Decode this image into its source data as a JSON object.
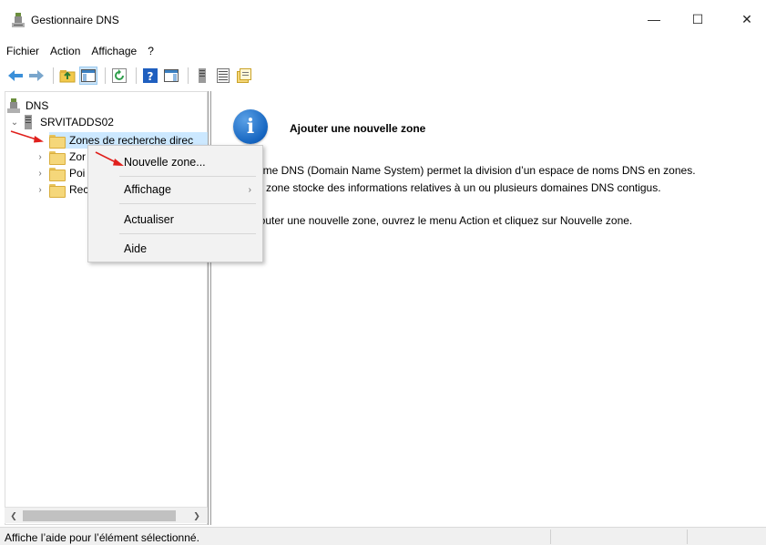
{
  "window": {
    "title": "Gestionnaire DNS",
    "minimize": "—",
    "maximize": "☐",
    "close": "✕"
  },
  "menu": [
    "Fichier",
    "Action",
    "Affichage",
    "?"
  ],
  "tree": {
    "root": "DNS",
    "server": "SRVITADDS02",
    "children": [
      {
        "label": "Zones de recherche direc"
      },
      {
        "label": "Zor"
      },
      {
        "label": "Poi"
      },
      {
        "label": "Rec"
      }
    ]
  },
  "context_menu": {
    "items": [
      "Nouvelle zone...",
      "Affichage",
      "Actualiser",
      "Aide"
    ]
  },
  "result": {
    "heading": "Ajouter une nouvelle zone",
    "line1": "ème DNS (Domain Name System) permet la division d’un espace de noms DNS en zones.",
    "line2": "e zone stocke des informations relatives à un ou plusieurs domaines DNS contigus.",
    "line3": "jouter une nouvelle zone, ouvrez le menu Action et cliquez sur Nouvelle zone."
  },
  "status": {
    "text": "Affiche l’aide pour l’élément sélectionné."
  },
  "colors": {
    "selection": "#cce8ff",
    "annotation_arrow": "#e0201c",
    "info_icon": "#1565c0"
  }
}
